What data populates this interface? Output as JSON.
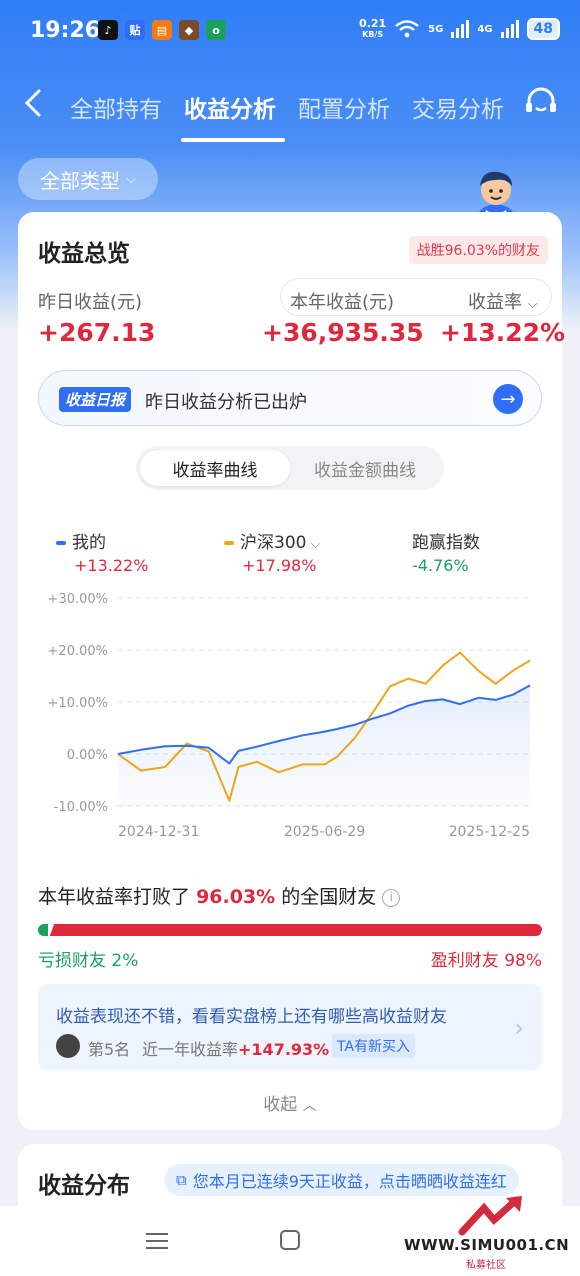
{
  "status": {
    "time": "19:26",
    "net_speed": "0.21",
    "net_unit": "KB/S",
    "sig1": "5G",
    "sig2": "4G",
    "battery": "48"
  },
  "nav": {
    "tabs": [
      {
        "label": "全部持有",
        "active": false
      },
      {
        "label": "收益分析",
        "active": true
      },
      {
        "label": "配置分析",
        "active": false
      },
      {
        "label": "交易分析",
        "active": false
      }
    ]
  },
  "filter": {
    "label": "全部类型"
  },
  "overview": {
    "title": "收益总览",
    "badge": "战胜96.03%的财友",
    "yesterday_label": "昨日收益(元)",
    "yesterday_value": "+267.13",
    "year_label": "本年收益(元)",
    "year_value": "+36,935.35",
    "rate_label": "收益率",
    "rate_value": "+13.22%"
  },
  "daily_report": {
    "tag": "收益日报",
    "text": "昨日收益分析已出炉"
  },
  "segment": {
    "options": [
      "收益率曲线",
      "收益金额曲线"
    ]
  },
  "legend": [
    {
      "name": "我的",
      "value": "+13.22%",
      "color": "#2f6ff5",
      "value_color": "#e0283c"
    },
    {
      "name": "沪深300",
      "value": "+17.98%",
      "color": "#f0a417",
      "value_color": "#e0283c"
    },
    {
      "name": "跑赢指数",
      "value": "-4.76%",
      "value_color": "#1aa15f"
    }
  ],
  "chart_data": {
    "type": "line",
    "xlabel": "",
    "ylabel": "",
    "y_ticks": [
      "+30.00%",
      "+20.00%",
      "+10.00%",
      "0.00%",
      "-10.00%"
    ],
    "x_ticks": [
      "2024-12-31",
      "2025-06-29",
      "2025-12-25"
    ],
    "ylim": [
      -10,
      30
    ],
    "x": [
      "2024-12-31",
      "2025-01-20",
      "2025-02-10",
      "2025-03-01",
      "2025-03-20",
      "2025-04-07",
      "2025-04-15",
      "2025-05-01",
      "2025-05-20",
      "2025-06-10",
      "2025-06-29",
      "2025-07-10",
      "2025-07-25",
      "2025-08-10",
      "2025-08-25",
      "2025-09-10",
      "2025-09-25",
      "2025-10-10",
      "2025-10-25",
      "2025-11-10",
      "2025-11-25",
      "2025-12-10",
      "2025-12-25"
    ],
    "series": [
      {
        "name": "我的",
        "color": "#2f6ff5",
        "values": [
          0.0,
          0.8,
          1.5,
          1.6,
          1.2,
          -1.8,
          0.6,
          1.4,
          2.5,
          3.6,
          4.3,
          4.8,
          5.6,
          6.8,
          7.8,
          9.3,
          10.2,
          10.5,
          9.6,
          10.8,
          10.4,
          11.4,
          13.2
        ]
      },
      {
        "name": "沪深300",
        "color": "#f0a417",
        "values": [
          0.0,
          -3.2,
          -2.5,
          2.0,
          0.5,
          -9.0,
          -2.5,
          -1.5,
          -3.5,
          -2.0,
          -2.0,
          -0.5,
          3.0,
          8.0,
          13.0,
          14.5,
          13.5,
          17.0,
          19.5,
          16.0,
          13.5,
          16.0,
          17.98
        ]
      }
    ]
  },
  "beat": {
    "prefix": "本年收益率打败了",
    "percent": "96.03%",
    "suffix": "的全国财友",
    "loss_label": "亏损财友 2%",
    "gain_label": "盈利财友 98%",
    "loss_share": 0.02
  },
  "promo": {
    "title": "收益表现还不错，看看实盘榜上还有哪些高收益财友",
    "rank": "第5名",
    "rate_prefix": "近一年收益率",
    "rate_value": "+147.93%",
    "tag": "TA有新买入"
  },
  "collapse": {
    "label": "收起"
  },
  "distribution": {
    "title": "收益分布",
    "notice": "您本月已连续9天正收益，点击晒晒收益连红"
  },
  "watermark": {
    "url": "WWW.SIMU001.CN",
    "sub": "私募社区"
  }
}
